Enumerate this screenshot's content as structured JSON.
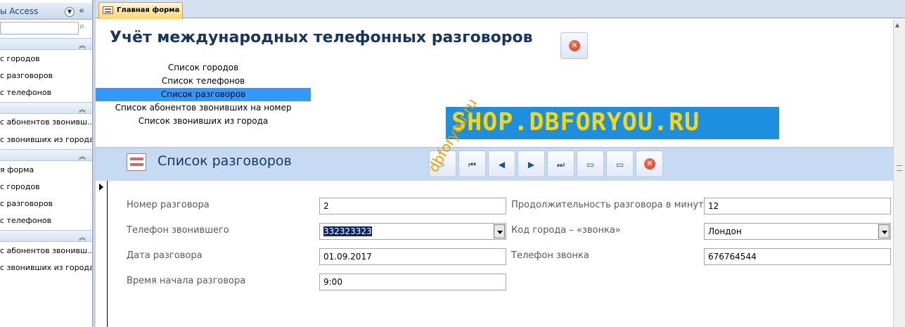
{
  "nav": {
    "title": "ы Access",
    "groups": [
      {
        "items": [
          "с городов",
          "с разговоров",
          "с телефонов"
        ]
      },
      {
        "items": [
          "с абонентов звонивш...",
          "с звонивших из города"
        ]
      },
      {
        "items": [
          "я форма",
          "с городов",
          "с разговоров",
          "с телефонов"
        ]
      },
      {
        "items": [
          "с абонентов звонивш...",
          "с звонивших из города"
        ]
      }
    ]
  },
  "tab": {
    "label": "Главная форма"
  },
  "form": {
    "title": "Учёт международных телефонных разговоров",
    "listbox": {
      "items": [
        "Список городов",
        "Список телефонов",
        "Список разговоров",
        "Список абонентов звонивших на номер",
        "Список звонивших из города"
      ],
      "selected_index": 2
    }
  },
  "watermark": {
    "text": "SHOP.DBFORYOU.RU",
    "diagonal": "dbforyou.ru"
  },
  "subform": {
    "title": "Список разговоров",
    "buttons": [
      "search",
      "first-record",
      "previous-record",
      "next-record",
      "last-record",
      "new-record",
      "delete-record",
      "close"
    ]
  },
  "fields": {
    "call_number": {
      "label": "Номер разговора",
      "value": "2"
    },
    "caller_phone": {
      "label": "Телефон звонившего",
      "value": "332323323"
    },
    "call_date": {
      "label": "Дата разговора",
      "value": "01.09.2017"
    },
    "start_time": {
      "label": "Время начала разговора",
      "value": "9:00"
    },
    "duration": {
      "label": "Продолжительность разговора в минута:",
      "value": "12"
    },
    "city_code": {
      "label": "Код города – «звонка»",
      "value": "Лондон"
    },
    "call_phone": {
      "label": "Телефон звонка",
      "value": "676764544"
    }
  },
  "colors": {
    "title": "#17365d",
    "selection": "#3399ff",
    "header_band": "#c6daf3",
    "watermark_bg": "#1e8fe0",
    "watermark_fg": "#ffd700"
  }
}
